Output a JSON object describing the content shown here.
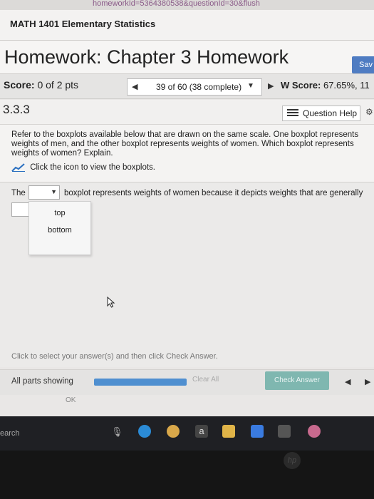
{
  "browser": {
    "url_fragment": "homeworkId=5364380538&questionId=30&flush"
  },
  "course": {
    "title": "MATH 1401 Elementary Statistics"
  },
  "homework": {
    "title": "Homework: Chapter 3 Homework",
    "save_label": "Sav"
  },
  "score": {
    "label": "Score:",
    "value": "0 of 2 pts",
    "nav_text": "39 of 60 (38 complete)",
    "hw_label": "W Score:",
    "hw_value": "67.65%, 11"
  },
  "question": {
    "number": "3.3.3",
    "help_label": "Question Help",
    "prompt": "Refer to the boxplots available below that are drawn on the same scale. One boxplot represents weights of men, and the other boxplot represents weights of women. Which boxplot represents weights of women? Explain.",
    "boxplot_link": "Click the icon to view the boxplots."
  },
  "answer": {
    "prefix": "The",
    "suffix": "boxplot represents weights of women because it depicts weights that are generally",
    "options": [
      "top",
      "bottom"
    ]
  },
  "footer": {
    "hint": "Click to select your answer(s) and then click Check Answer.",
    "parts_label": "All parts showing",
    "parts_progress": 1.0,
    "clear_label": "Clear All",
    "check_label": "Check Answer",
    "ok_text": "OK"
  },
  "taskbar": {
    "search_label": "earch"
  },
  "colors": {
    "accent": "#4f7cc2",
    "check_button": "#7fb7b0",
    "progress": "#4f8fd0"
  }
}
